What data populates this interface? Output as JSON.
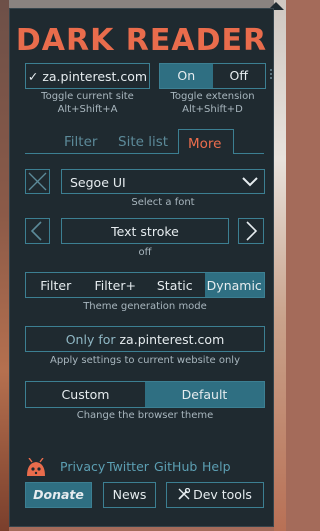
{
  "app": {
    "title": "DARK READER"
  },
  "site_toggle": {
    "label": "✓ za.pinterest.com",
    "caption_line1": "Toggle current site",
    "caption_line2": "Alt+Shift+A"
  },
  "ext_toggle": {
    "on_label": "On",
    "off_label": "Off",
    "selected": "On",
    "caption_line1": "Toggle extension",
    "caption_line2": "Alt+Shift+D"
  },
  "tabs": [
    {
      "label": "Filter",
      "active": false
    },
    {
      "label": "Site list",
      "active": false
    },
    {
      "label": "More",
      "active": true
    }
  ],
  "font": {
    "value": "Segoe UI",
    "caption": "Select a font"
  },
  "text_stroke": {
    "label": "Text stroke",
    "value": "off"
  },
  "theme_mode": {
    "options": [
      "Filter",
      "Filter+",
      "Static",
      "Dynamic"
    ],
    "selected": "Dynamic",
    "caption": "Theme generation mode"
  },
  "only_for": {
    "prefix": "Only for",
    "site": "za.pinterest.com",
    "caption": "Apply settings to current website only"
  },
  "browser_theme": {
    "options": [
      "Custom",
      "Default"
    ],
    "selected": "Default",
    "caption": "Change the browser theme"
  },
  "footer": {
    "links": [
      "Privacy",
      "Twitter",
      "GitHub",
      "Help"
    ],
    "donate_label": "Donate",
    "news_label": "News",
    "devtools_label": "Dev tools"
  },
  "colors": {
    "accent": "#e96c4c",
    "border": "#3c7f92",
    "selected": "#2f6f82",
    "background": "#1f2a30"
  }
}
